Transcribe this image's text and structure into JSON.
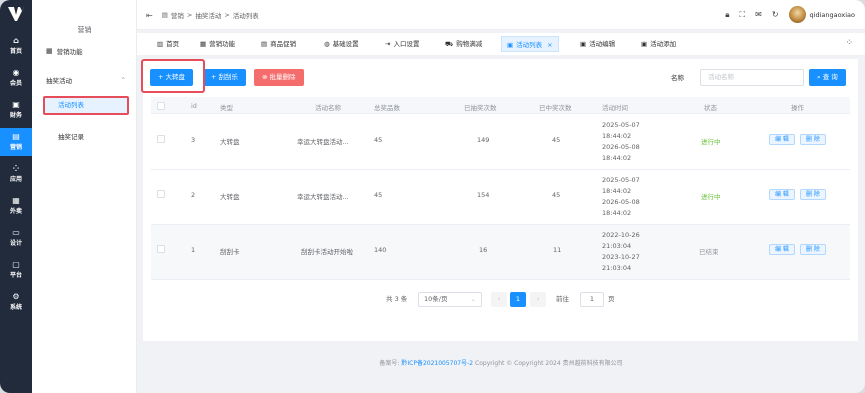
{
  "rail": {
    "items": [
      {
        "label": "首页",
        "icon": "home-icon",
        "glyph": "⌂"
      },
      {
        "label": "会员",
        "icon": "user-icon",
        "glyph": "◉"
      },
      {
        "label": "财务",
        "icon": "wallet-icon",
        "glyph": "▣"
      },
      {
        "label": "营销",
        "icon": "marketing-icon",
        "glyph": "▤"
      },
      {
        "label": "应用",
        "icon": "apps-icon",
        "glyph": "⁘"
      },
      {
        "label": "外卖",
        "icon": "takeout-icon",
        "glyph": "▦"
      },
      {
        "label": "设计",
        "icon": "design-icon",
        "glyph": "▭"
      },
      {
        "label": "平台",
        "icon": "platform-icon",
        "glyph": "▢"
      },
      {
        "label": "系统",
        "icon": "gear-icon",
        "glyph": "⚙"
      }
    ],
    "active_index": 3
  },
  "submenu": {
    "title": "营销",
    "items": [
      {
        "label": "营销功能"
      },
      {
        "label": "抽奖活动"
      },
      {
        "label": "活动列表"
      },
      {
        "label": "抽奖记录"
      }
    ]
  },
  "breadcrumb": [
    "营销",
    ">",
    "抽奖活动",
    ">",
    "活动列表"
  ],
  "user": {
    "name": "qidiangaoxiao"
  },
  "tabs": [
    {
      "label": "首页"
    },
    {
      "label": "营销功能"
    },
    {
      "label": "商品促销"
    },
    {
      "label": "基础设置"
    },
    {
      "label": "入口设置"
    },
    {
      "label": "购物满减"
    },
    {
      "label": "活动列表",
      "close": "×"
    },
    {
      "label": "活动编辑"
    },
    {
      "label": "活动添加"
    }
  ],
  "toolbar": {
    "add_wheel": "+ 大转盘",
    "add_scratch": "+ 刮刮乐",
    "batch_delete": "批量删除",
    "search_label": "名称",
    "search_placeholder": "活动名称",
    "search_button": "查 询"
  },
  "table": {
    "headers": [
      "id",
      "类型",
      "活动名称",
      "总奖品数",
      "已抽奖次数",
      "已中奖次数",
      "活动时间",
      "状态",
      "操作"
    ],
    "rows": [
      {
        "id": "3",
        "type": "大转盘",
        "name": "幸运大转盘活动...",
        "total": "45",
        "drawn": "149",
        "won": "45",
        "time": [
          "2025-05-07",
          "18:44:02",
          "2026-05-08",
          "18:44:02"
        ],
        "status": "进行中",
        "status_color": "#67c23a",
        "edit": "编 辑",
        "del": "删 除"
      },
      {
        "id": "2",
        "type": "大转盘",
        "name": "幸运大转盘活动...",
        "total": "45",
        "drawn": "154",
        "won": "45",
        "time": [
          "2025-05-07",
          "18:44:02",
          "2026-05-08",
          "18:44:02"
        ],
        "status": "进行中",
        "status_color": "#67c23a",
        "edit": "编 辑",
        "del": "删 除"
      },
      {
        "id": "1",
        "type": "刮刮卡",
        "name": "刮刮卡活动开始啦",
        "total": "140",
        "drawn": "16",
        "won": "11",
        "time": [
          "2022-10-26",
          "21:03:04",
          "2023-10-27",
          "21:03:04"
        ],
        "status": "已结束",
        "status_color": "#909399",
        "edit": "编 辑",
        "del": "删 除"
      }
    ]
  },
  "pagination": {
    "total_text": "共 3 条",
    "page_size": "10条/页",
    "current_page": "1",
    "goto_label": "前往",
    "goto_value": "1",
    "page_unit": "页"
  },
  "footer": {
    "prefix": "备案号:",
    "icp": "黔ICP备2021005707号-2",
    "copyright": "Copyright  ©  Copyright 2024 贵州越前科技有限公司"
  }
}
